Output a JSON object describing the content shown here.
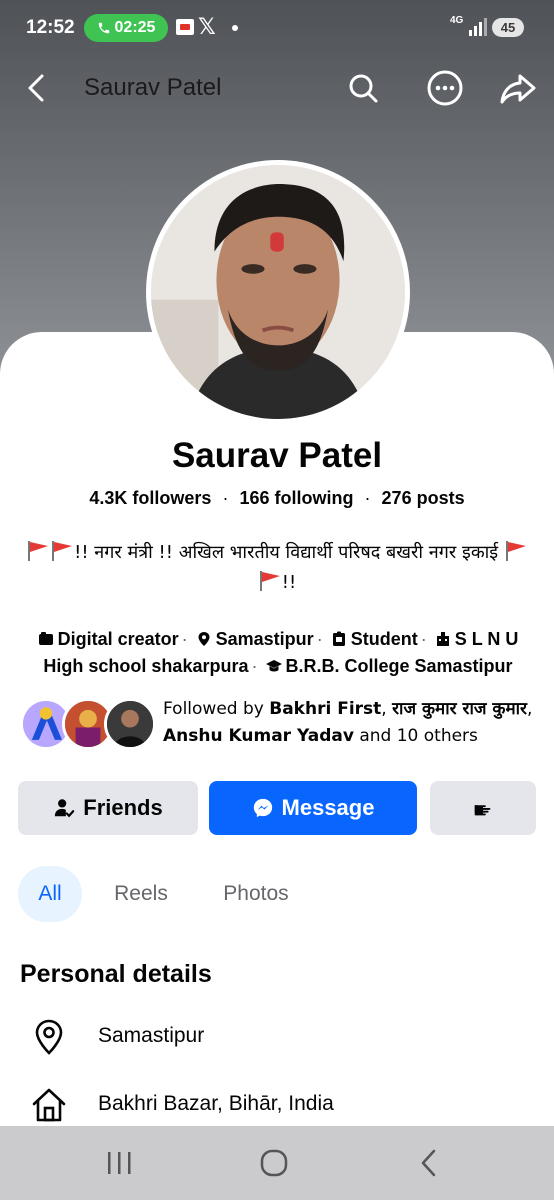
{
  "status_bar": {
    "time": "12:52",
    "call_timer": "02:25",
    "x_glyph": "𝕏",
    "network": "4G",
    "battery": "45"
  },
  "header": {
    "title": "Saurav Patel"
  },
  "profile": {
    "name": "Saurav Patel",
    "followers": "4.3K",
    "followers_label": "followers",
    "following": "166",
    "following_label": "following",
    "posts": "276",
    "posts_label": "posts",
    "separator": "·",
    "bio_text": "!! नगर मंत्री !! अखिल भारतीय विद्यार्थी परिषद बखरी नगर इकाई",
    "bio_end": "!!"
  },
  "details_line": {
    "category": "Digital creator",
    "location": "Samastipur",
    "role": "Student",
    "school": "S L N U High school shakarpura",
    "college": "B.R.B. College Samastipur"
  },
  "followed_by": {
    "prefix": "Followed by",
    "name1": "Bakhri First",
    "comma1": ",",
    "name2": "राज कुमार राज कुमार",
    "comma2": ",",
    "name3": "Anshu Kumar Yadav",
    "suffix": "and 10 others"
  },
  "actions": {
    "friends_label": "Friends",
    "message_label": "Message"
  },
  "tabs": [
    {
      "label": "All"
    },
    {
      "label": "Reels"
    },
    {
      "label": "Photos"
    }
  ],
  "personal_details": {
    "title": "Personal details",
    "items": [
      {
        "icon": "location-pin-icon",
        "text": "Samastipur"
      },
      {
        "icon": "home-icon",
        "text": "Bakhri Bazar, Bihār, India"
      }
    ]
  },
  "colors": {
    "accent": "#0866ff",
    "button_gray": "#e4e6eb",
    "tab_active_bg": "#e7f3ff",
    "call_green": "#3fc353"
  }
}
